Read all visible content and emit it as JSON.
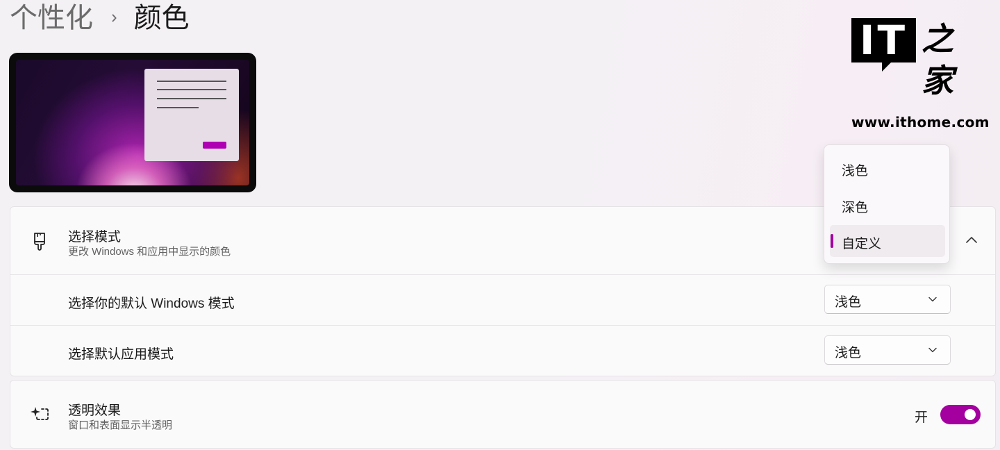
{
  "breadcrumb": {
    "parent": "个性化",
    "separator": "›",
    "current": "颜色"
  },
  "logo": {
    "it": "IT",
    "cn": "之家",
    "url": "www.ithome.com"
  },
  "mode_section": {
    "icon": "paintbrush-icon",
    "title": "选择模式",
    "subtitle": "更改 Windows 和应用中显示的颜色",
    "expanded": true,
    "dropdown_options": [
      "浅色",
      "深色",
      "自定义"
    ],
    "selected_option": "自定义",
    "windows_mode": {
      "label": "选择你的默认 Windows 模式",
      "value": "浅色"
    },
    "app_mode": {
      "label": "选择默认应用模式",
      "value": "浅色"
    }
  },
  "transparency": {
    "icon": "sparkle-transparency-icon",
    "title": "透明效果",
    "subtitle": "窗口和表面显示半透明",
    "state_label": "开",
    "on": true
  },
  "colors": {
    "accent": "#a3009f",
    "background": "#f3f1f4",
    "card": "#fbfafb"
  }
}
